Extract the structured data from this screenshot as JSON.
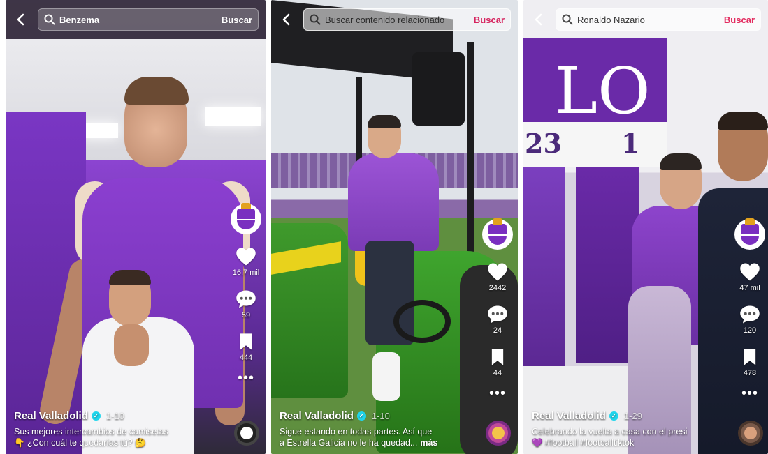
{
  "panels": [
    {
      "search_query": "Benzema",
      "search_button": "Buscar",
      "likes": "16,7 mil",
      "comments": "59",
      "saves": "444",
      "author": "Real Valladolid",
      "date": "1-10",
      "desc_line1": "Sus mejores intercambios de camisetas",
      "desc_line2": "👇 ¿Con cuál te quedarías tú? 🤔"
    },
    {
      "search_query": "Buscar contenido relacionado",
      "search_button": "Buscar",
      "likes": "2442",
      "comments": "24",
      "saves": "44",
      "author": "Real Valladolid",
      "date": "1-10",
      "desc_line1": "Sigue estando en todas partes. Así que",
      "desc_line2": "a Estrella Galicia no le ha quedad...",
      "more": "más"
    },
    {
      "search_query": "Ronaldo Nazario",
      "search_button": "Buscar",
      "likes": "47 mil",
      "comments": "120",
      "saves": "478",
      "author": "Real Valladolid",
      "date": "1-29",
      "desc_line1": "Celebrando la vuelta a casa con el presi",
      "desc_line2": "💜 #football #footballtiktok"
    }
  ],
  "scene_text": {
    "banner": "LO",
    "num_left": "23",
    "num_right": "1"
  },
  "colors": {
    "accent": "#e32b5f",
    "club_purple": "#7a2fc0",
    "verified": "#20d5ec"
  }
}
